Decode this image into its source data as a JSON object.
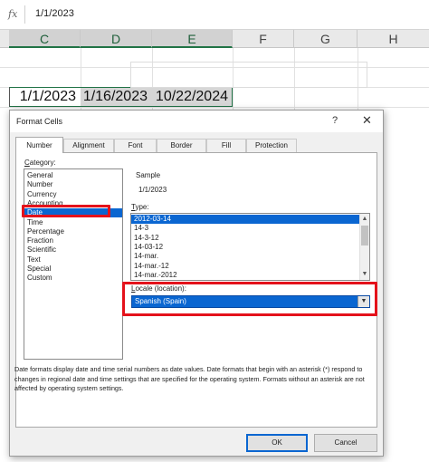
{
  "formula_bar": {
    "fx_symbol": "fx",
    "value": "1/1/2023"
  },
  "columns": [
    "C",
    "D",
    "E",
    "F",
    "G",
    "H"
  ],
  "cells": [
    "1/1/2023",
    "1/16/2023",
    "10/22/2024"
  ],
  "dialog": {
    "title": "Format Cells",
    "help": "?",
    "close": "✕",
    "tabs": [
      "Number",
      "Alignment",
      "Font",
      "Border",
      "Fill",
      "Protection"
    ],
    "active_tab": "Number",
    "category": {
      "label_underline": "C",
      "label_rest": "ategory:",
      "items": [
        "General",
        "Number",
        "Currency",
        "Accounting",
        "Date",
        "Time",
        "Percentage",
        "Fraction",
        "Scientific",
        "Text",
        "Special",
        "Custom"
      ],
      "selected": "Date"
    },
    "sample": {
      "label": "Sample",
      "value": "1/1/2023"
    },
    "type": {
      "label_underline": "T",
      "label_rest": "ype:",
      "items": [
        "2012-03-14",
        "14-3",
        "14-3-12",
        "14-03-12",
        "14-mar.",
        "14-mar.-12",
        "14-mar.-2012"
      ],
      "selected": "2012-03-14"
    },
    "locale": {
      "label_underline": "L",
      "label_rest": "ocale (location):",
      "value": "Spanish (Spain)"
    },
    "description": "Date formats display date and time serial numbers as date values.  Date formats that begin with an asterisk (*) respond to changes in regional date and time settings that are specified for the operating system. Formats without an asterisk are not affected by operating system settings.",
    "ok_label": "OK",
    "cancel_label": "Cancel"
  },
  "colors": {
    "accent": "#0a66d1",
    "highlight_red": "#e4121b",
    "excel_green": "#217346"
  }
}
